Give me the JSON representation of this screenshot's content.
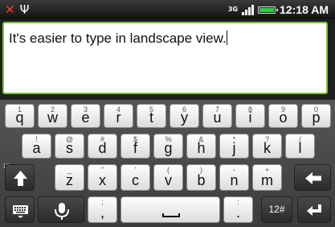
{
  "status_bar": {
    "missed_call_icon": "missed-call-icon",
    "usb_icon": "usb-icon",
    "network_type": "3G",
    "signal_icon": "signal-bars-icon",
    "battery_icon": "battery-icon",
    "battery_color": "#2ecc40",
    "time": "12:18 AM"
  },
  "editor": {
    "text": "It's easier to type in landscape view.",
    "border_color": "#7cc23a"
  },
  "keyboard": {
    "side_marker": "10",
    "rows": [
      {
        "keys": [
          {
            "main": "q",
            "alt": "1"
          },
          {
            "main": "w",
            "alt": "2"
          },
          {
            "main": "e",
            "alt": "3"
          },
          {
            "main": "r",
            "alt": "4"
          },
          {
            "main": "t",
            "alt": "5"
          },
          {
            "main": "y",
            "alt": "6"
          },
          {
            "main": "u",
            "alt": "7"
          },
          {
            "main": "i",
            "alt": "8"
          },
          {
            "main": "o",
            "alt": "9"
          },
          {
            "main": "p",
            "alt": "0"
          }
        ]
      },
      {
        "keys": [
          {
            "main": "a",
            "alt": "!"
          },
          {
            "main": "s",
            "alt": "@"
          },
          {
            "main": "d",
            "alt": "#"
          },
          {
            "main": "f",
            "alt": "$"
          },
          {
            "main": "g",
            "alt": "%"
          },
          {
            "main": "h",
            "alt": "&"
          },
          {
            "main": "j",
            "alt": "*"
          },
          {
            "main": "k",
            "alt": "?"
          },
          {
            "main": "l",
            "alt": "/"
          }
        ]
      },
      {
        "shift_icon": "shift-arrow-icon",
        "keys": [
          {
            "main": "z",
            "alt": "_"
          },
          {
            "main": "x",
            "alt": "\""
          },
          {
            "main": "c",
            "alt": "'"
          },
          {
            "main": "v",
            "alt": "("
          },
          {
            "main": "b",
            "alt": ")"
          },
          {
            "main": "n",
            "alt": "-"
          },
          {
            "main": "m",
            "alt": "+"
          }
        ],
        "backspace_icon": "backspace-arrow-icon"
      },
      {
        "hide_keyboard_icon": "keyboard-icon",
        "mic_icon": "microphone-icon",
        "comma": {
          "main": ",",
          "alt": ";"
        },
        "space_icon": "space-bar-icon",
        "period": {
          "main": ".",
          "alt": ":"
        },
        "symbols_label": "12#",
        "enter_icon": "enter-arrow-icon"
      }
    ]
  }
}
